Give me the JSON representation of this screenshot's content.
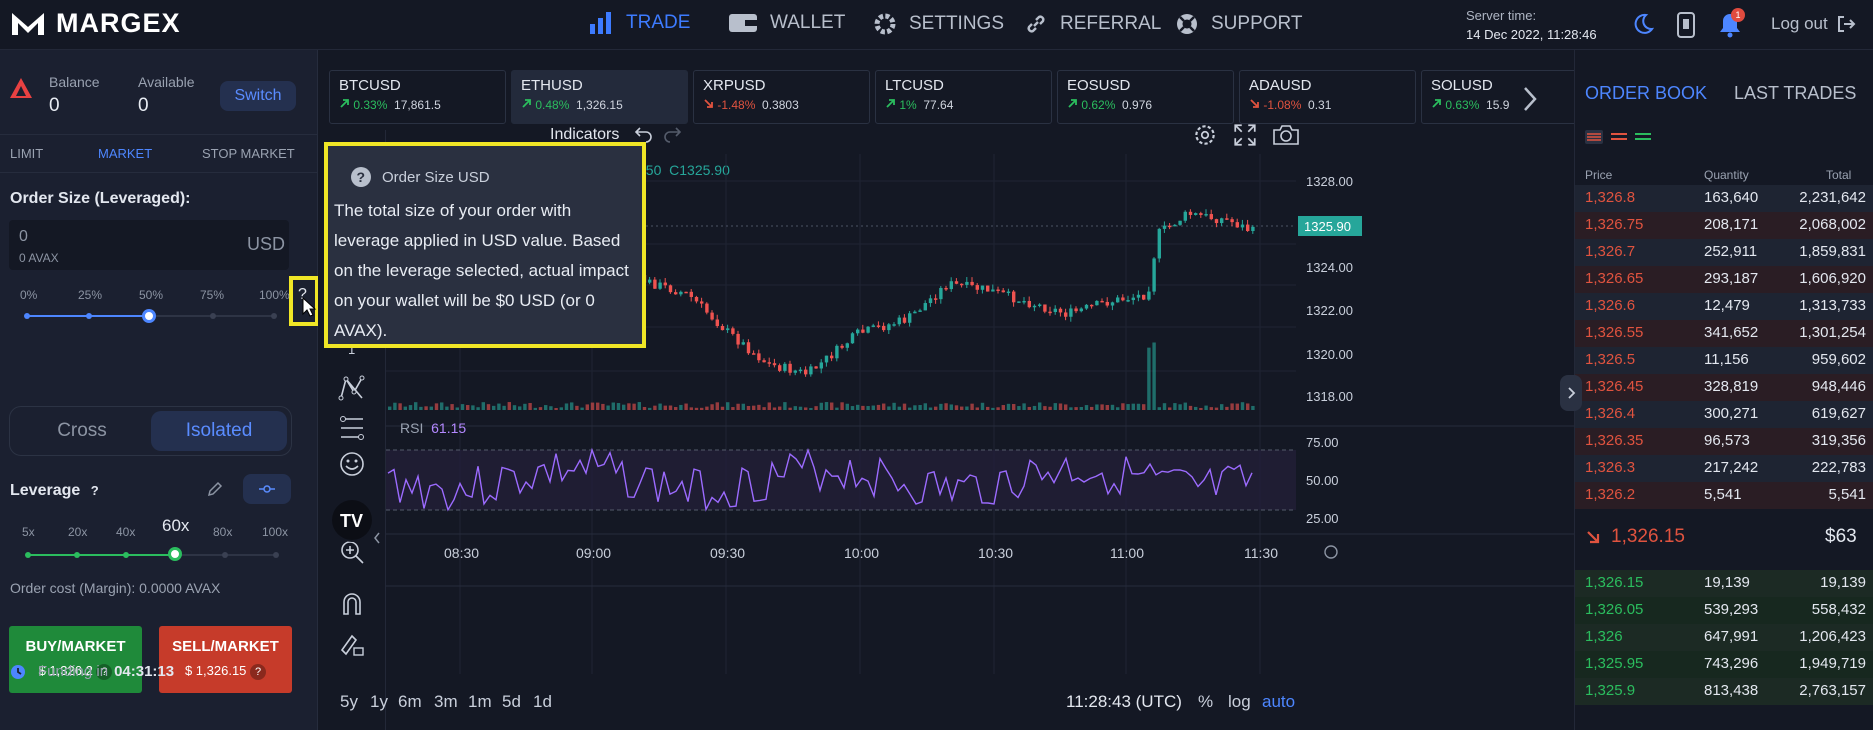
{
  "brand": {
    "name": "MARGEX"
  },
  "nav": [
    {
      "label": "TRADE",
      "icon": "bar-chart-icon"
    },
    {
      "label": "WALLET",
      "icon": "wallet-icon"
    },
    {
      "label": "SETTINGS",
      "icon": "gear-icon"
    },
    {
      "label": "REFERRAL",
      "icon": "link-icon"
    },
    {
      "label": "SUPPORT",
      "icon": "lifebuoy-icon"
    }
  ],
  "server": {
    "label": "Server time:",
    "time": "14 Dec 2022, 11:28:46"
  },
  "notifications": {
    "count": "1"
  },
  "logout": "Log out",
  "left": {
    "balance_label": "Balance",
    "balance": "0",
    "available_label": "Available",
    "available": "0",
    "switch_label": "Switch",
    "order_types": [
      "LIMIT",
      "MARKET",
      "STOP MARKET"
    ],
    "order_size_label": "Order Size (Leveraged):",
    "order_size_value": "0",
    "order_size_sub": "0 AVAX",
    "order_size_unit": "USD",
    "help_mark": "?",
    "percents": [
      "0%",
      "25%",
      "50%",
      "75%",
      "100%"
    ],
    "size_fraction": 0.5,
    "margin_mode": {
      "cross": "Cross",
      "isolated": "Isolated"
    },
    "leverage_label": "Leverage",
    "leverage_opts": [
      "5x",
      "20x",
      "40x",
      "60x",
      "80x",
      "100x"
    ],
    "leverage_selected": "60x",
    "order_cost": "Order cost (Margin): 0.0000 AVAX",
    "buy_label": "BUY/MARKET",
    "buy_price": "$ 1,326.2",
    "sell_label": "SELL/MARKET",
    "sell_price": "$ 1,326.15",
    "funding_label": "Funding in",
    "funding_time": "04:31:13"
  },
  "tickers": [
    {
      "sym": "BTCUSD",
      "chg": "0.33%",
      "price": "17,861.5",
      "dir": "up"
    },
    {
      "sym": "ETHUSD",
      "chg": "0.48%",
      "price": "1,326.15",
      "dir": "up"
    },
    {
      "sym": "XRPUSD",
      "chg": "-1.48%",
      "price": "0.3803",
      "dir": "down"
    },
    {
      "sym": "LTCUSD",
      "chg": "1%",
      "price": "77.64",
      "dir": "up"
    },
    {
      "sym": "EOSUSD",
      "chg": "0.62%",
      "price": "0.976",
      "dir": "up"
    },
    {
      "sym": "ADAUSD",
      "chg": "-1.08%",
      "price": "0.31",
      "dir": "down"
    },
    {
      "sym": "SOLUSD",
      "chg": "0.63%",
      "price": "15.9",
      "dir": "up"
    }
  ],
  "chart": {
    "indicators_label": "Indicators",
    "ohlc_partial": "150",
    "close_label": "C1325.90",
    "price_axis": [
      "1328.00",
      "1326.00",
      "1324.00",
      "1322.00",
      "1320.00",
      "1318.00"
    ],
    "last_price": "1325.90",
    "rsi_label": "RSI",
    "rsi_value": "61.15",
    "rsi_axis": [
      "75.00",
      "50.00",
      "25.00"
    ],
    "time_axis": [
      "08:30",
      "09:00",
      "09:30",
      "10:00",
      "10:30",
      "11:00",
      "11:30"
    ],
    "timeframes": [
      "5y",
      "1y",
      "6m",
      "3m",
      "1m",
      "5d",
      "1d"
    ],
    "clock": "11:28:43 (UTC)",
    "scale_opts": [
      "%",
      "log",
      "auto"
    ],
    "tool_num": "1",
    "up_color": "#26a69a",
    "down_color": "#ef5350"
  },
  "tooltip": {
    "title": "Order Size USD",
    "body": "The total size of your order with leverage applied in USD value. Based on the leverage selected, actual impact on your wallet will be $0 USD (or 0 AVAX)."
  },
  "orderbook": {
    "tabs": [
      "ORDER BOOK",
      "LAST TRADES"
    ],
    "headers": [
      "Price",
      "Quantity",
      "Total"
    ],
    "asks": [
      [
        "1,326.8",
        "163,640",
        "2,231,642"
      ],
      [
        "1,326.75",
        "208,171",
        "2,068,002"
      ],
      [
        "1,326.7",
        "252,911",
        "1,859,831"
      ],
      [
        "1,326.65",
        "293,187",
        "1,606,920"
      ],
      [
        "1,326.6",
        "12,479",
        "1,313,733"
      ],
      [
        "1,326.55",
        "341,652",
        "1,301,254"
      ],
      [
        "1,326.5",
        "11,156",
        "959,602"
      ],
      [
        "1,326.45",
        "328,819",
        "948,446"
      ],
      [
        "1,326.4",
        "300,271",
        "619,627"
      ],
      [
        "1,326.35",
        "96,573",
        "319,356"
      ],
      [
        "1,326.3",
        "217,242",
        "222,783"
      ],
      [
        "1,326.2",
        "5,541",
        "5,541"
      ]
    ],
    "mid_price": "1,326.15",
    "mid_value": "$63",
    "bids": [
      [
        "1,326.15",
        "19,139",
        "19,139"
      ],
      [
        "1,326.05",
        "539,293",
        "558,432"
      ],
      [
        "1,326",
        "647,991",
        "1,206,423"
      ],
      [
        "1,325.95",
        "743,296",
        "1,949,719"
      ],
      [
        "1,325.9",
        "813,438",
        "2,763,157"
      ]
    ]
  }
}
